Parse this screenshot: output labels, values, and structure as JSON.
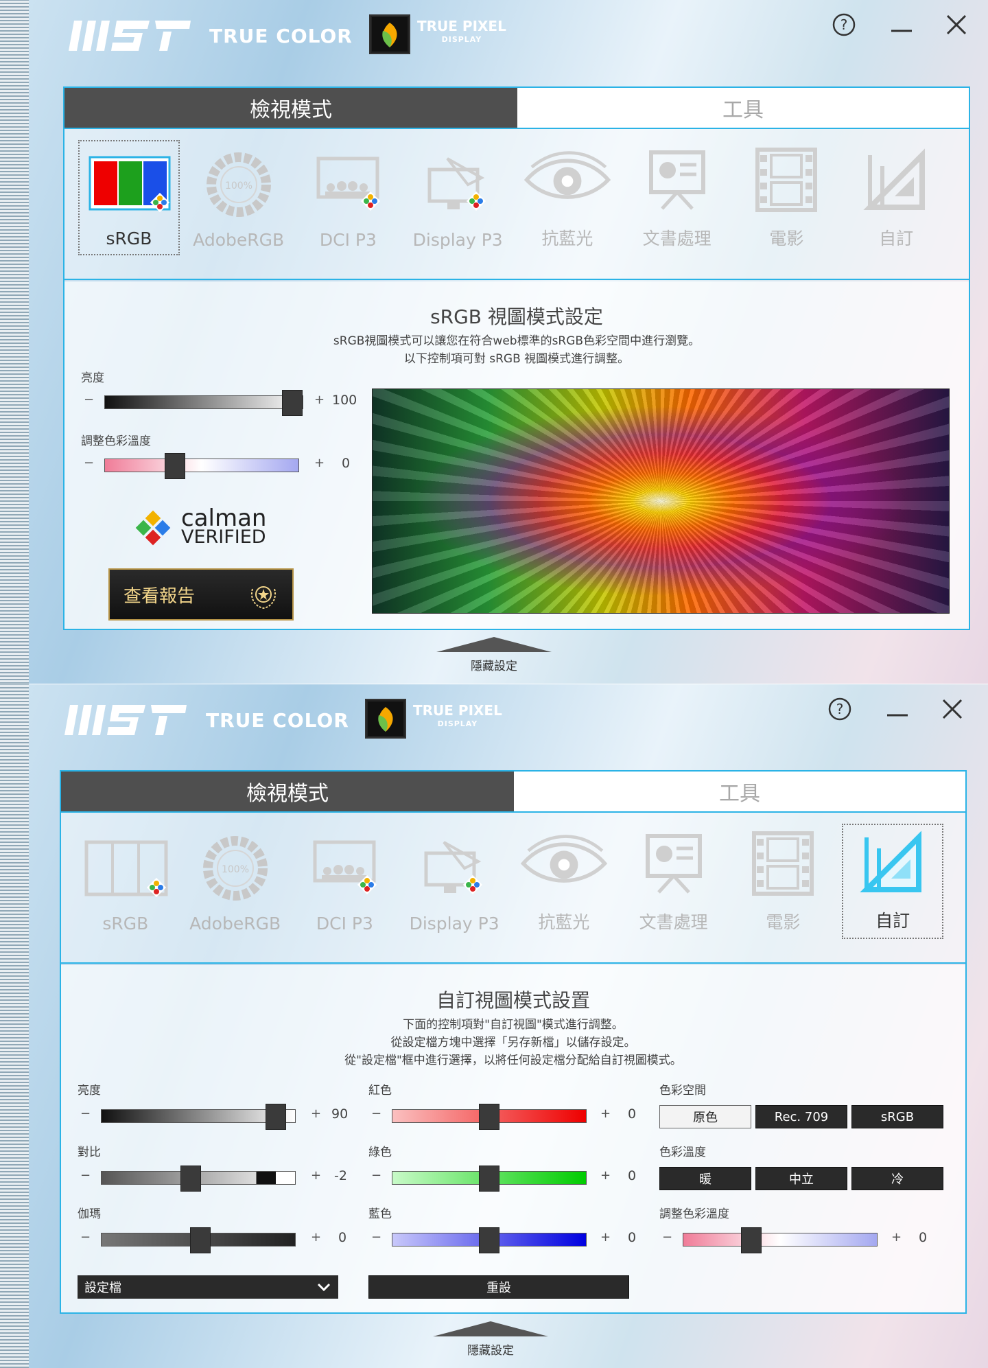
{
  "brand": {
    "logo_text": "MSI",
    "product": "TRUE COLOR",
    "badge_title": "TRUE PIXEL",
    "badge_sub": "DISPLAY"
  },
  "window_buttons": {
    "help": "?"
  },
  "tabs": {
    "view": "檢視模式",
    "tools": "工具"
  },
  "modes": [
    "sRGB",
    "AdobeRGB",
    "DCI P3",
    "Display P3",
    "抗藍光",
    "文書處理",
    "電影",
    "自訂"
  ],
  "adobe_badge": "100%",
  "hide_settings": "隱藏設定",
  "w1": {
    "title": "sRGB 視圖模式設定",
    "desc1": "sRGB視圖模式可以讓您在符合web標準的sRGB色彩空間中進行瀏覽。",
    "desc2": "以下控制項可對 sRGB 視圖模式進行調整。",
    "brightness_label": "亮度",
    "brightness_value": "100",
    "brightness_level": 100,
    "temp_label": "調整色彩溫度",
    "temp_value": "0",
    "temp_level": 0.36,
    "calman_1": "calman",
    "calman_2": "VERIFIED",
    "report_button": "查看報告",
    "selected_mode": "sRGB"
  },
  "w2": {
    "title": "自訂視圖模式設置",
    "desc1": "下面的控制項對\"自訂視圖\"模式進行調整。",
    "desc2": "從設定檔方塊中選擇「另存新檔」以儲存設定。",
    "desc3": "從\"設定檔\"框中進行選擇，以將任何設定檔分配給自訂視圖模式。",
    "brightness_label": "亮度",
    "brightness_value": "90",
    "brightness_level": 90,
    "contrast_label": "對比",
    "contrast_value": "-2",
    "contrast_level": 0.46,
    "gamma_label": "伽瑪",
    "gamma_value": "0",
    "gamma_level": 0.51,
    "red_label": "紅色",
    "red_value": "0",
    "red_level": 0.5,
    "green_label": "綠色",
    "green_value": "0",
    "green_level": 0.5,
    "blue_label": "藍色",
    "blue_value": "0",
    "blue_level": 0.5,
    "colorspace_label": "色彩空間",
    "colorspace": [
      "原色",
      "Rec. 709",
      "sRGB"
    ],
    "colortemp_label": "色彩溫度",
    "colortemp": [
      "暖",
      "中立",
      "冷"
    ],
    "adjust_temp_label": "調整色彩溫度",
    "adjust_temp_value": "0",
    "adjust_temp_level": 0.35,
    "profile_dropdown": "設定檔",
    "reset_button": "重設",
    "selected_mode": "自訂"
  },
  "signs": {
    "minus": "−",
    "plus": "+"
  }
}
